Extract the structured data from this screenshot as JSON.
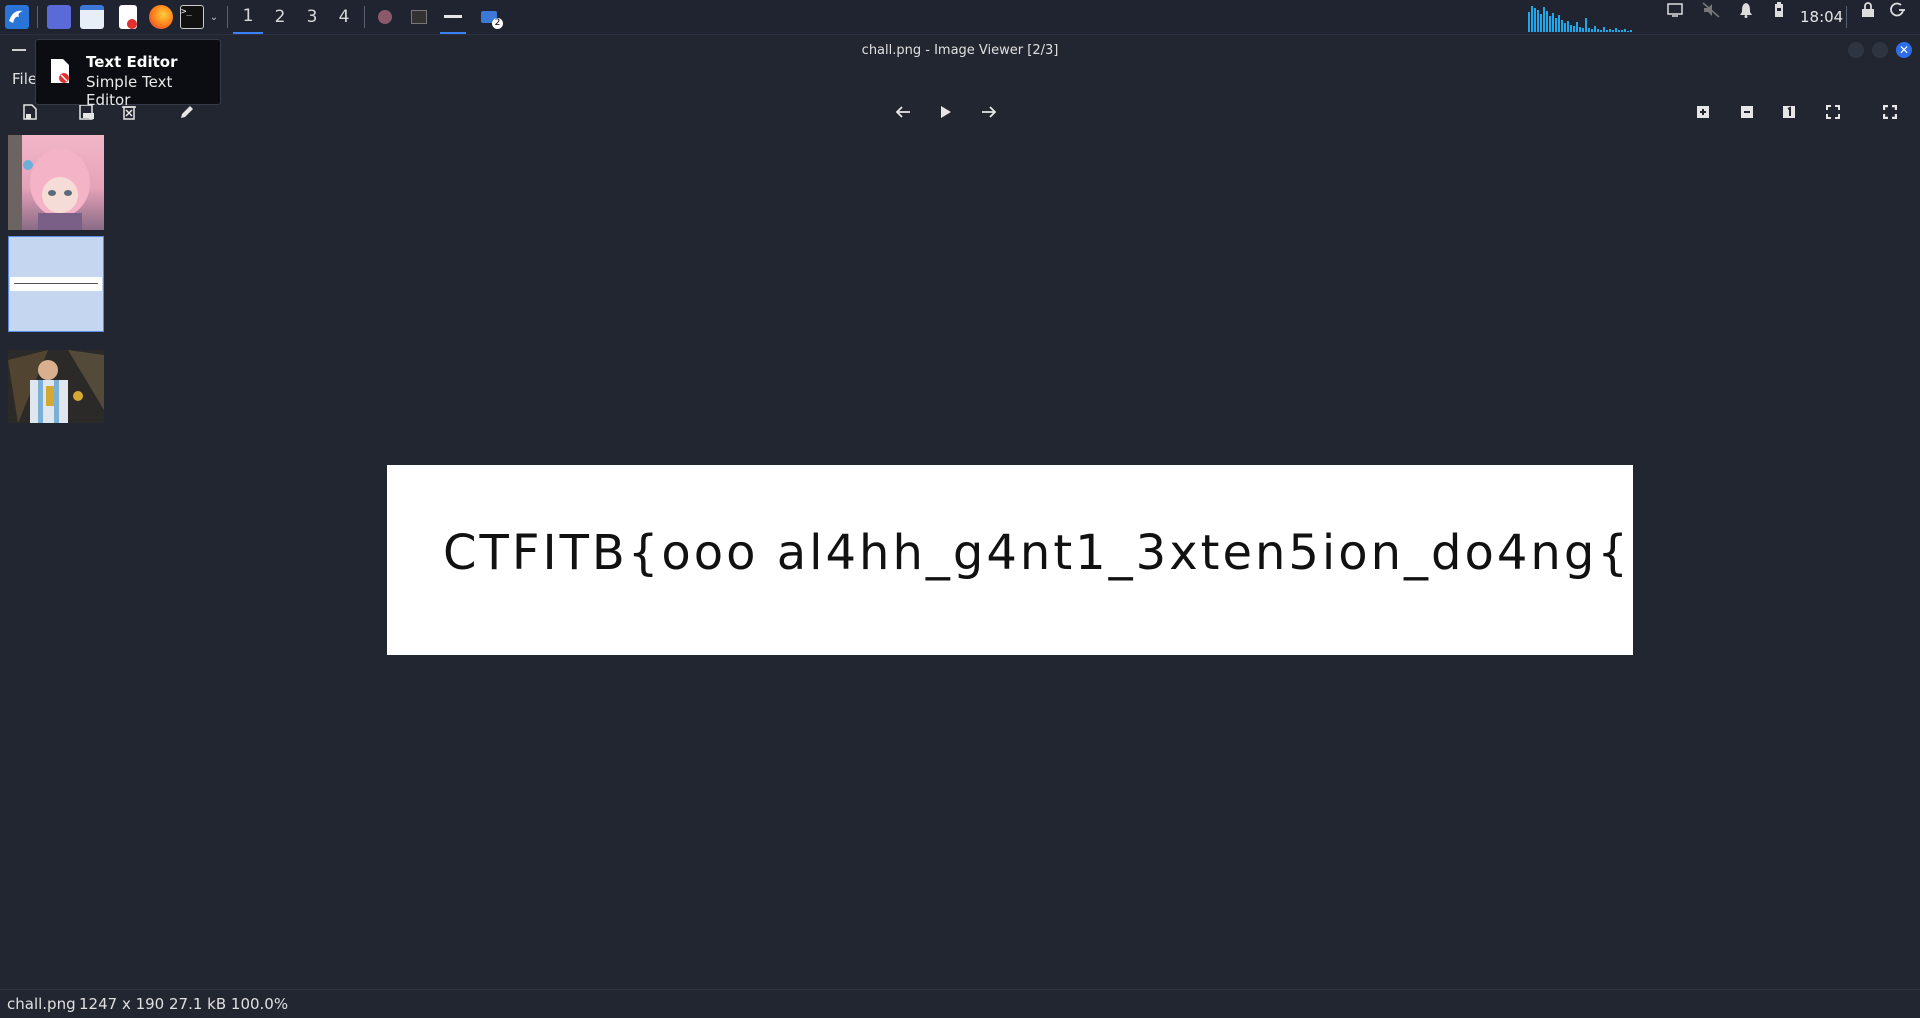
{
  "taskbar": {
    "workspaces": [
      "1",
      "2",
      "3",
      "4"
    ],
    "active_workspace": "1",
    "badge_count": "2",
    "clock": "18:04"
  },
  "window": {
    "title": "chall.png - Image Viewer [2/3]"
  },
  "menu": {
    "file": "File"
  },
  "tooltip": {
    "title": "Text Editor",
    "subtitle": "Simple Text Editor"
  },
  "image": {
    "handwritten_text": "CTFITB{ooo al4hh_g4nt1_3xten5ion_do4ng{"
  },
  "status": {
    "filename": "chall.png",
    "info": "1247 x 190 27.1 kB 100.0%"
  },
  "colors": {
    "accent": "#3b82f6",
    "background": "#222631",
    "close_button": "#2e6ee8"
  }
}
